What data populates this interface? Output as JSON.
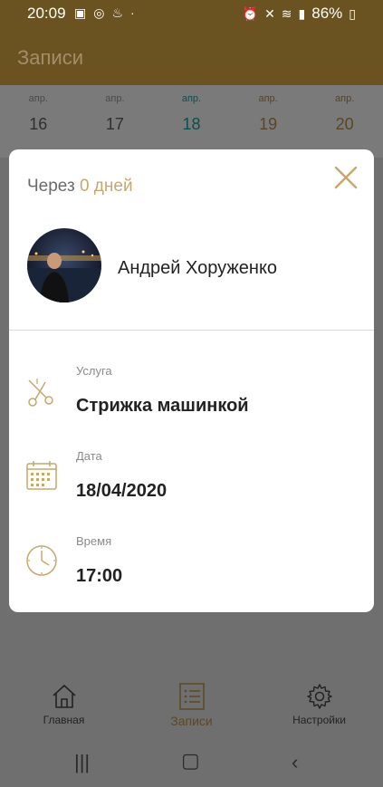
{
  "status_bar": {
    "time": "20:09",
    "battery": "86%",
    "left_icons": [
      "image-icon",
      "instagram-icon",
      "notification-icon",
      "dot-icon"
    ],
    "right_icons": [
      "alarm-icon",
      "mute-icon",
      "wifi-icon",
      "signal-icon",
      "battery-icon"
    ]
  },
  "app_bar": {
    "title": "Записи"
  },
  "dates": [
    {
      "month": "апр.",
      "day": "16",
      "state": "past"
    },
    {
      "month": "апр.",
      "day": "17",
      "state": "past"
    },
    {
      "month": "апр.",
      "day": "18",
      "state": "active"
    },
    {
      "month": "апр.",
      "day": "19",
      "state": "future"
    },
    {
      "month": "апр.",
      "day": "20",
      "state": "future"
    }
  ],
  "modal": {
    "header_prefix": "Через",
    "header_days": "0 дней",
    "client_name": "Андрей Хоруженко",
    "service_label": "Услуга",
    "service_value": "Стрижка машинкой",
    "date_label": "Дата",
    "date_value": "18/04/2020",
    "time_label": "Время",
    "time_value": "17:00"
  },
  "bottom_nav": [
    {
      "label": "Главная",
      "icon": "home-icon",
      "active": false
    },
    {
      "label": "Записи",
      "icon": "list-icon",
      "active": true
    },
    {
      "label": "Настройки",
      "icon": "gear-icon",
      "active": false
    }
  ],
  "colors": {
    "accent": "#c8a76d",
    "app_bar": "#6b5321",
    "overlay": "#6f6f6f"
  }
}
